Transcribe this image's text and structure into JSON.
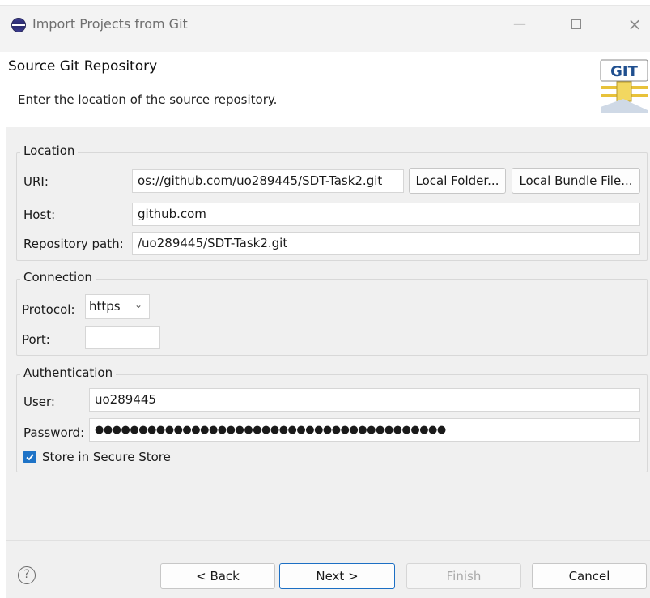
{
  "window": {
    "title": "Import Projects from Git",
    "minimize_glyph": "—",
    "close_glyph": "×"
  },
  "header": {
    "title": "Source Git Repository",
    "description": "Enter the location of the source repository.",
    "logo_text": "GIT"
  },
  "location": {
    "legend": "Location",
    "uri_label": "URI:",
    "uri_value": "os://github.com/uo289445/SDT-Task2.git",
    "local_folder_button": "Local Folder...",
    "local_bundle_button": "Local Bundle File...",
    "host_label": "Host:",
    "host_value": "github.com",
    "repo_path_label": "Repository path:",
    "repo_path_value": "/uo289445/SDT-Task2.git"
  },
  "connection": {
    "legend": "Connection",
    "protocol_label": "Protocol:",
    "protocol_value": "https",
    "port_label": "Port:",
    "port_value": ""
  },
  "authentication": {
    "legend": "Authentication",
    "user_label": "User:",
    "user_value": "uo289445",
    "password_label": "Password:",
    "password_mask": "●●●●●●●●●●●●●●●●●●●●●●●●●●●●●●●●●●●●●●●●",
    "store_label": "Store in Secure Store",
    "store_checked": true
  },
  "footer": {
    "help_glyph": "?",
    "back_button": "< Back",
    "next_button": "Next >",
    "finish_button": "Finish",
    "cancel_button": "Cancel"
  },
  "colors": {
    "accent": "#1e73c7",
    "panel": "#f0f0f0",
    "logo_gold": "#e8c23a"
  }
}
